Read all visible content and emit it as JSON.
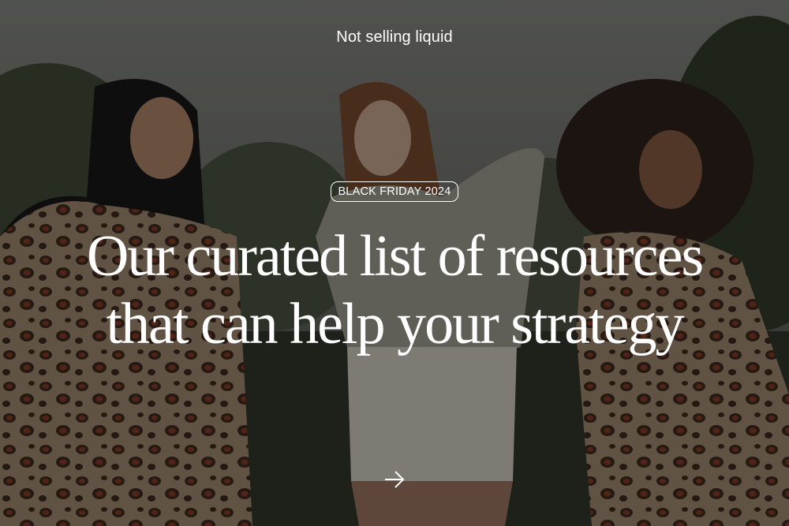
{
  "brand": {
    "label": "Not selling liquid"
  },
  "hero": {
    "badge": "BLACK FRIDAY 2024",
    "headline_line1": "Our curated list of resources",
    "headline_line2": "that can help your strategy",
    "next_icon": "arrow-right-icon"
  },
  "colors": {
    "text": "#ffffff",
    "overlay": "#0a0a0a"
  }
}
